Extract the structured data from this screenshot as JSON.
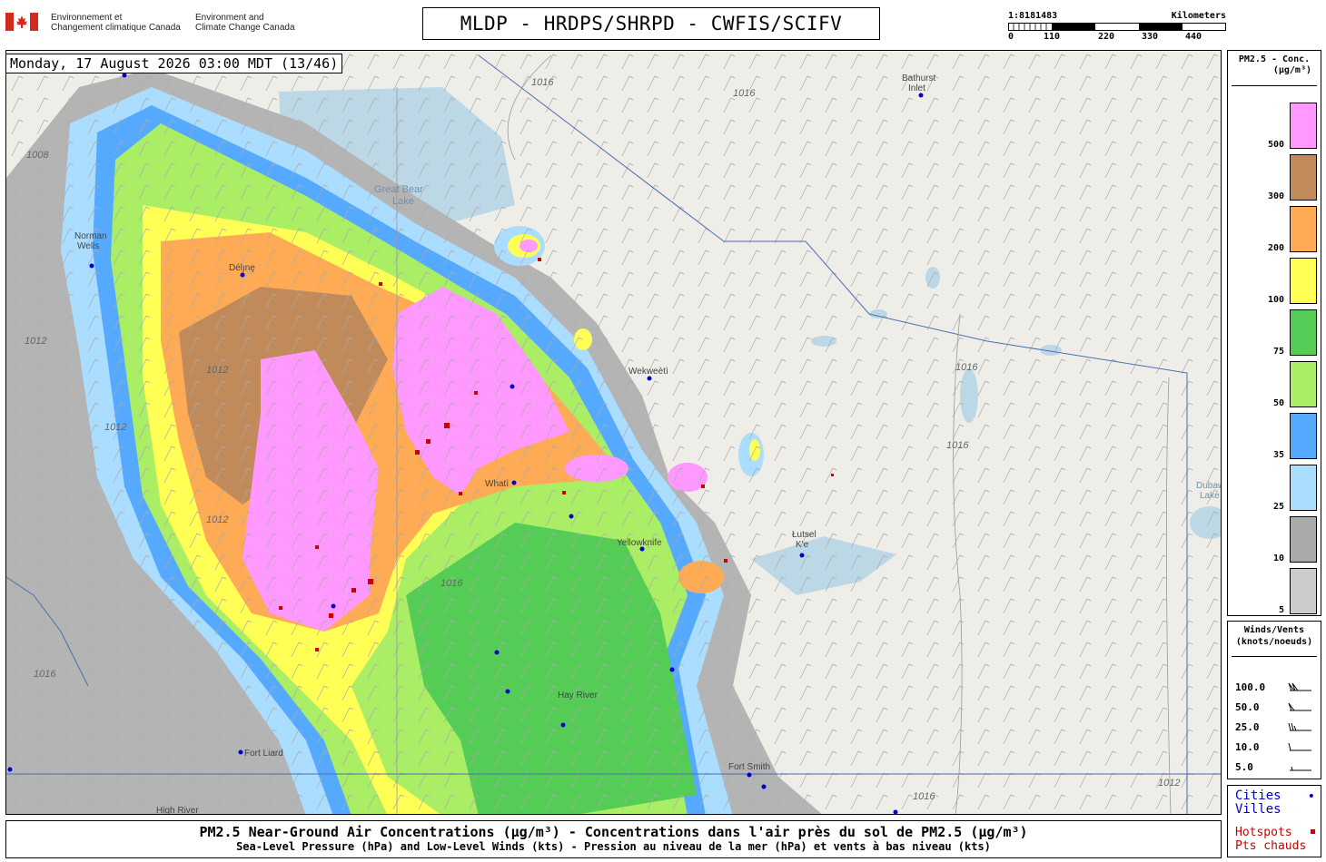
{
  "header": {
    "gov_fr_1": "Environnement et",
    "gov_fr_2": "Changement climatique Canada",
    "gov_en_1": "Environment and",
    "gov_en_2": "Climate Change Canada",
    "title": "MLDP - HRDPS/SHRPD - CWFIS/SCIFV",
    "scale_ratio": "1:8181483",
    "scale_unit": "Kilometers",
    "scale_ticks": [
      "0",
      "110",
      "220",
      "330",
      "440"
    ]
  },
  "map": {
    "timestamp": "Monday, 17 August 2026 03:00 MDT (13/46)",
    "places": [
      {
        "name": "Bathurst",
        "name2": "Inlet"
      },
      {
        "name": "Great Bear",
        "name2": "Lake"
      },
      {
        "name": "Norman",
        "name2": "Wells"
      },
      {
        "name": "Délı̨nę",
        "name2": ""
      },
      {
        "name": "Wekweètì",
        "name2": ""
      },
      {
        "name": "Whatì",
        "name2": ""
      },
      {
        "name": "Yellowknife",
        "name2": ""
      },
      {
        "name": "Łutsel",
        "name2": "K'e"
      },
      {
        "name": "Dubawnt",
        "name2": "Lake"
      },
      {
        "name": "Hay River",
        "name2": ""
      },
      {
        "name": "Fort Liard",
        "name2": ""
      },
      {
        "name": "Fort Smith",
        "name2": ""
      },
      {
        "name": "High River",
        "name2": ""
      }
    ],
    "isobar_labels": [
      "1016",
      "1016",
      "1016",
      "1016",
      "1016",
      "1012",
      "1012",
      "1012",
      "1012",
      "1008",
      "1016",
      "1016",
      "1012"
    ]
  },
  "legend": {
    "title_1": "PM2.5 - Conc.",
    "title_2": "(µg/m³)",
    "bins": [
      {
        "label": "500",
        "color": "#ff99ff"
      },
      {
        "label": "300",
        "color": "#c18a5a"
      },
      {
        "label": "200",
        "color": "#ffaa55"
      },
      {
        "label": "100",
        "color": "#ffff55"
      },
      {
        "label": "75",
        "color": "#55cc55"
      },
      {
        "label": "50",
        "color": "#aaee66"
      },
      {
        "label": "35",
        "color": "#55aaff"
      },
      {
        "label": "25",
        "color": "#aaddff"
      },
      {
        "label": "10",
        "color": "#aaaaaa"
      },
      {
        "label": "5",
        "color": "#cccccc"
      }
    ]
  },
  "winds": {
    "title_1": "Winds/Vents",
    "title_2": "(knots/noeuds)",
    "rows": [
      "100.0",
      "50.0",
      "25.0",
      "10.0",
      "5.0"
    ]
  },
  "markers": {
    "cities_1": "Cities",
    "cities_2": "Villes",
    "hotspots_1": "Hotspots",
    "hotspots_2": "Pts chauds",
    "city_color": "#0000cc",
    "hotspot_color": "#cc0000"
  },
  "footer": {
    "line1": "PM2.5 Near-Ground Air Concentrations (µg/m³) - Concentrations dans l'air près du sol de PM2.5 (µg/m³)",
    "line2": "Sea-Level Pressure (hPa) and Low-Level Winds (kts) - Pression au niveau de la mer (hPa) et vents à bas niveau (kts)"
  }
}
